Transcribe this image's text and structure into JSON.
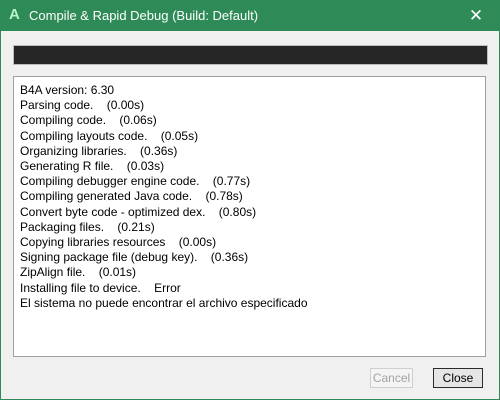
{
  "window": {
    "app_icon_glyph": "A",
    "title": "Compile & Rapid Debug (Build: Default)",
    "close_glyph": "✕",
    "accent_color": "#2e8b57"
  },
  "progress": {
    "percent": 100
  },
  "log": {
    "lines": [
      "B4A version: 6.30",
      "Parsing code.    (0.00s)",
      "Compiling code.    (0.06s)",
      "Compiling layouts code.    (0.05s)",
      "Organizing libraries.    (0.36s)",
      "Generating R file.    (0.03s)",
      "Compiling debugger engine code.    (0.77s)",
      "Compiling generated Java code.    (0.78s)",
      "Convert byte code - optimized dex.    (0.80s)",
      "Packaging files.    (0.21s)",
      "Copying libraries resources    (0.00s)",
      "Signing package file (debug key).    (0.36s)",
      "ZipAlign file.    (0.01s)",
      "Installing file to device.    Error",
      "El sistema no puede encontrar el archivo especificado"
    ]
  },
  "buttons": {
    "cancel_label": "Cancel",
    "close_label": "Close"
  }
}
